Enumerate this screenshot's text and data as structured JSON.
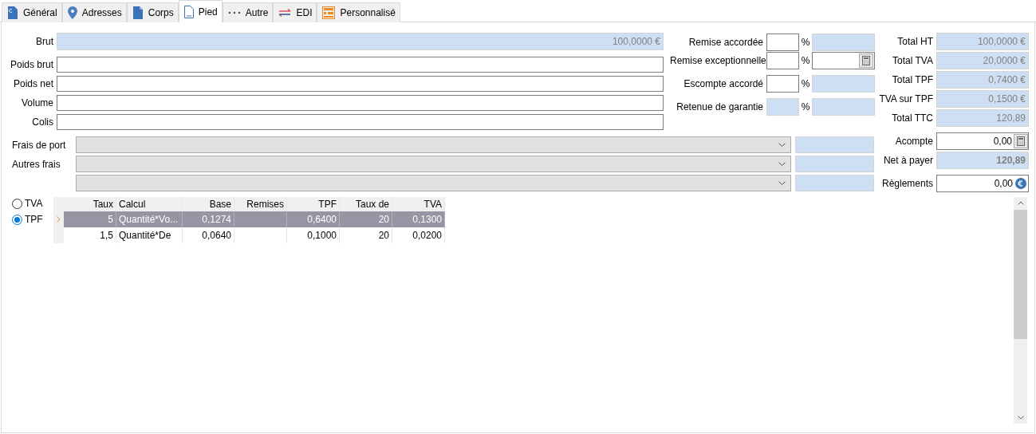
{
  "tabs": [
    {
      "label": "Général",
      "selected": false
    },
    {
      "label": "Adresses",
      "selected": false
    },
    {
      "label": "Corps",
      "selected": false
    },
    {
      "label": "Pied",
      "selected": true
    },
    {
      "label": "Autre",
      "selected": false
    },
    {
      "label": "EDI",
      "selected": false
    },
    {
      "label": "Personnalisé",
      "selected": false
    }
  ],
  "fields": [
    {
      "label": "Brut",
      "value": "100,0000 €",
      "readonly": true
    },
    {
      "label": "Poids brut",
      "readonly": false
    },
    {
      "label": "Poids net",
      "readonly": false
    },
    {
      "label": "Volume",
      "readonly": false
    },
    {
      "label": "Colis",
      "readonly": false
    }
  ],
  "discounts": [
    {
      "label": "Remise accordée",
      "percent_readonly": false,
      "unit": "%",
      "amount_readonly": true
    },
    {
      "label": "Remise exceptionnelle",
      "percent_readonly": false,
      "unit": "%",
      "amount_readonly": false,
      "calculator": true
    },
    {
      "label": "Escompte accordé",
      "percent_readonly": false,
      "unit": "%",
      "amount_readonly": true
    },
    {
      "label": "Retenue de garantie",
      "percent_readonly": true,
      "unit": "%",
      "amount_readonly": true
    }
  ],
  "charges": [
    {
      "kind": "labeled",
      "label": "Frais de port"
    },
    {
      "kind": "labeled",
      "label": "Autres frais"
    },
    {
      "kind": "unlabeled"
    }
  ],
  "totals": [
    {
      "label": "Total HT",
      "value": "100,0000 €",
      "kind": "readonly"
    },
    {
      "label": "Total TVA",
      "value": "20,0000 €",
      "kind": "readonly"
    },
    {
      "label": "Total TPF",
      "value": "0,7400 €",
      "kind": "readonly"
    },
    {
      "label": "TVA sur TPF",
      "value": "0,1500 €",
      "kind": "readonly"
    },
    {
      "label": "Total TTC",
      "value": "120,89",
      "kind": "readonly"
    }
  ],
  "payments": [
    {
      "label": "Acompte",
      "value": "0,00",
      "kind": "calculator"
    },
    {
      "label": "Net à payer",
      "value": "120,89",
      "kind": "readonly"
    },
    {
      "label": "Règlements",
      "value": "0,00",
      "kind": "euro"
    }
  ],
  "tax_modes": [
    {
      "label": "TVA",
      "selected": false
    },
    {
      "label": "TPF",
      "selected": true
    }
  ],
  "table": {
    "columns": [
      "Taux",
      "Calcul",
      "Base",
      "Remises",
      "TPF",
      "Taux de",
      "TVA"
    ],
    "rows": [
      {
        "cells": [
          "5",
          "Quantité*Vo...",
          "0,1274",
          "",
          "0,6400",
          "20",
          "0,1300"
        ],
        "selected": true
      },
      {
        "cells": [
          "1,5",
          "Quantité*De",
          "0,0640",
          "",
          "0,1000",
          "20",
          "0,0200"
        ],
        "selected": false
      }
    ]
  }
}
